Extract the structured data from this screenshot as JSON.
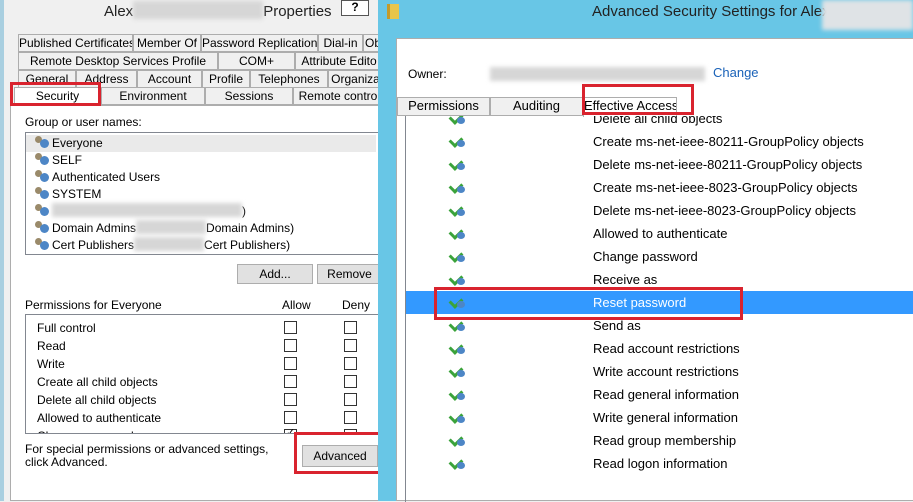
{
  "properties_dialog": {
    "title_prefix": "Alex",
    "title_suffix": "Properties",
    "help_button": "?",
    "tab_rows": [
      [
        "Published Certificates",
        "Member Of",
        "Password Replication",
        "Dial-in",
        "Ob"
      ],
      [
        "Remote Desktop Services Profile",
        "COM+",
        "Attribute Edito"
      ],
      [
        "General",
        "Address",
        "Account",
        "Profile",
        "Telephones",
        "Organiza"
      ],
      [
        "Security",
        "Environment",
        "Sessions",
        "Remote contro"
      ]
    ],
    "selected_tab": "Security",
    "group_label": "Group or user names:",
    "users": [
      {
        "name": "Everyone",
        "suffix": ""
      },
      {
        "name": "SELF",
        "suffix": ""
      },
      {
        "name": "Authenticated Users",
        "suffix": ""
      },
      {
        "name": "SYSTEM",
        "suffix": ""
      },
      {
        "name": "",
        "suffix": ")"
      },
      {
        "name": "Domain Admins",
        "suffix": "Domain Admins)"
      },
      {
        "name": "Cert Publishers",
        "suffix": "Cert Publishers)"
      }
    ],
    "add_button": "Add...",
    "remove_button": "Remove",
    "permissions_label": "Permissions for Everyone",
    "allow_label": "Allow",
    "deny_label": "Deny",
    "permissions": [
      {
        "name": "Full control",
        "allow": false,
        "deny": false
      },
      {
        "name": "Read",
        "allow": false,
        "deny": false
      },
      {
        "name": "Write",
        "allow": false,
        "deny": false
      },
      {
        "name": "Create all child objects",
        "allow": false,
        "deny": false
      },
      {
        "name": "Delete all child objects",
        "allow": false,
        "deny": false
      },
      {
        "name": "Allowed to authenticate",
        "allow": false,
        "deny": false
      },
      {
        "name": "Change password",
        "allow": true,
        "deny": false
      }
    ],
    "advanced_hint": "For special permissions or advanced settings, click Advanced.",
    "advanced_button": "Advanced"
  },
  "advanced_window": {
    "title": "Advanced Security Settings for Alexa",
    "owner_label": "Owner:",
    "change_link": "Change",
    "tabs": [
      "Permissions",
      "Auditing",
      "Effective Access"
    ],
    "selected_tab": "Effective Access",
    "entries": [
      "Delete all child objects",
      "Create ms-net-ieee-80211-GroupPolicy objects",
      "Delete ms-net-ieee-80211-GroupPolicy objects",
      "Create ms-net-ieee-8023-GroupPolicy objects",
      "Delete ms-net-ieee-8023-GroupPolicy objects",
      "Allowed to authenticate",
      "Change password",
      "Receive as",
      "Reset password",
      "Send as",
      "Read account restrictions",
      "Write account restrictions",
      "Read general information",
      "Write general information",
      "Read group membership",
      "Read logon information"
    ],
    "selected_entry": "Reset password",
    "highlight_color": "#3399ff",
    "title_bar_color": "#68c6e6",
    "highlight_box_color": "#d9232e"
  }
}
